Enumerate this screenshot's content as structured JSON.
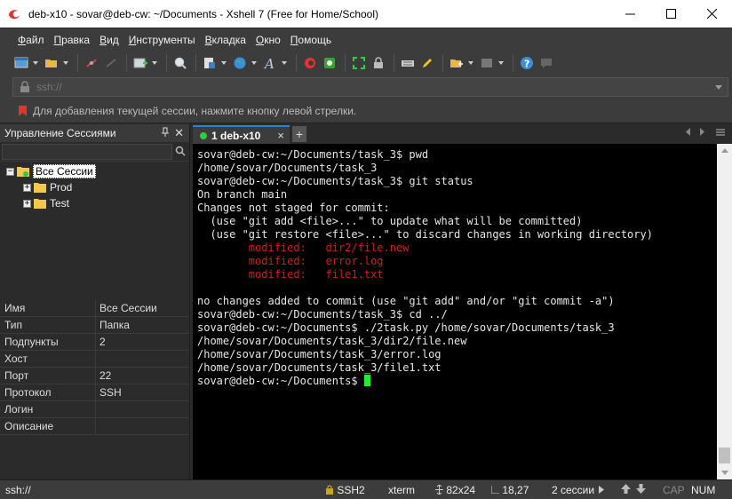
{
  "window": {
    "title": "deb-x10 - sovar@deb-cw: ~/Documents - Xshell 7 (Free for Home/School)"
  },
  "menu": [
    {
      "u": "Ф",
      "rest": "айл"
    },
    {
      "u": "П",
      "rest": "равка"
    },
    {
      "u": "В",
      "rest": "ид"
    },
    {
      "u": "И",
      "rest": "нструменты"
    },
    {
      "u": "В",
      "rest": "кладка"
    },
    {
      "u": "О",
      "rest": "кно"
    },
    {
      "u": "П",
      "rest": "омощь"
    }
  ],
  "address": {
    "value": "",
    "placeholder": "ssh://"
  },
  "hint": "Для добавления текущей сессии, нажмите кнопку левой стрелки.",
  "sessions_panel": {
    "title": "Управление Сессиями",
    "pin": "ᵖ",
    "close": "✕",
    "tree": {
      "root": "Все Сессии",
      "children": [
        "Prod",
        "Test"
      ]
    }
  },
  "properties": [
    {
      "key": "Имя",
      "value": "Все Сессии"
    },
    {
      "key": "Тип",
      "value": "Папка"
    },
    {
      "key": "Подпункты",
      "value": "2"
    },
    {
      "key": "Хост",
      "value": ""
    },
    {
      "key": "Порт",
      "value": "22"
    },
    {
      "key": "Протокол",
      "value": "SSH"
    },
    {
      "key": "Логин",
      "value": ""
    },
    {
      "key": "Описание",
      "value": ""
    }
  ],
  "tabs": [
    {
      "label": "1 deb-x10",
      "close": "×"
    }
  ],
  "tab_add": "+",
  "terminal": {
    "lines": [
      {
        "text": "sovar@deb-cw:~/Documents/task_3$ pwd",
        "color": "normal"
      },
      {
        "text": "/home/sovar/Documents/task_3",
        "color": "normal"
      },
      {
        "text": "sovar@deb-cw:~/Documents/task_3$ git status",
        "color": "normal"
      },
      {
        "text": "On branch main",
        "color": "normal"
      },
      {
        "text": "Changes not staged for commit:",
        "color": "normal"
      },
      {
        "text": "  (use \"git add <file>...\" to update what will be committed)",
        "color": "normal"
      },
      {
        "text": "  (use \"git restore <file>...\" to discard changes in working directory)",
        "color": "normal"
      },
      {
        "text": "        modified:   dir2/file.new",
        "color": "red"
      },
      {
        "text": "        modified:   error.log",
        "color": "red"
      },
      {
        "text": "        modified:   file1.txt",
        "color": "red"
      },
      {
        "text": "",
        "color": "normal"
      },
      {
        "text": "no changes added to commit (use \"git add\" and/or \"git commit -a\")",
        "color": "normal"
      },
      {
        "text": "sovar@deb-cw:~/Documents/task_3$ cd ../",
        "color": "normal"
      },
      {
        "text": "sovar@deb-cw:~/Documents$ ./2task.py /home/sovar/Documents/task_3",
        "color": "normal"
      },
      {
        "text": "/home/sovar/Documents/task_3/dir2/file.new",
        "color": "normal"
      },
      {
        "text": "/home/sovar/Documents/task_3/error.log",
        "color": "normal"
      },
      {
        "text": "/home/sovar/Documents/task_3/file1.txt",
        "color": "normal"
      },
      {
        "text": "sovar@deb-cw:~/Documents$ ",
        "color": "normal",
        "cursor": true
      }
    ]
  },
  "status": {
    "address": "ssh://",
    "protocol": "SSH2",
    "term": "xterm",
    "size": "82x24",
    "position": "18,27",
    "sessions": "2 сессии",
    "cap": "CAP",
    "num": "NUM"
  },
  "colors": {
    "terminal_bg": "#000000",
    "terminal_fg": "#e6e6e6",
    "modified": "#d21d1d",
    "cursor": "#1fef2f",
    "tab_accent": "#2e7fd6",
    "connected": "#2ecc40"
  }
}
